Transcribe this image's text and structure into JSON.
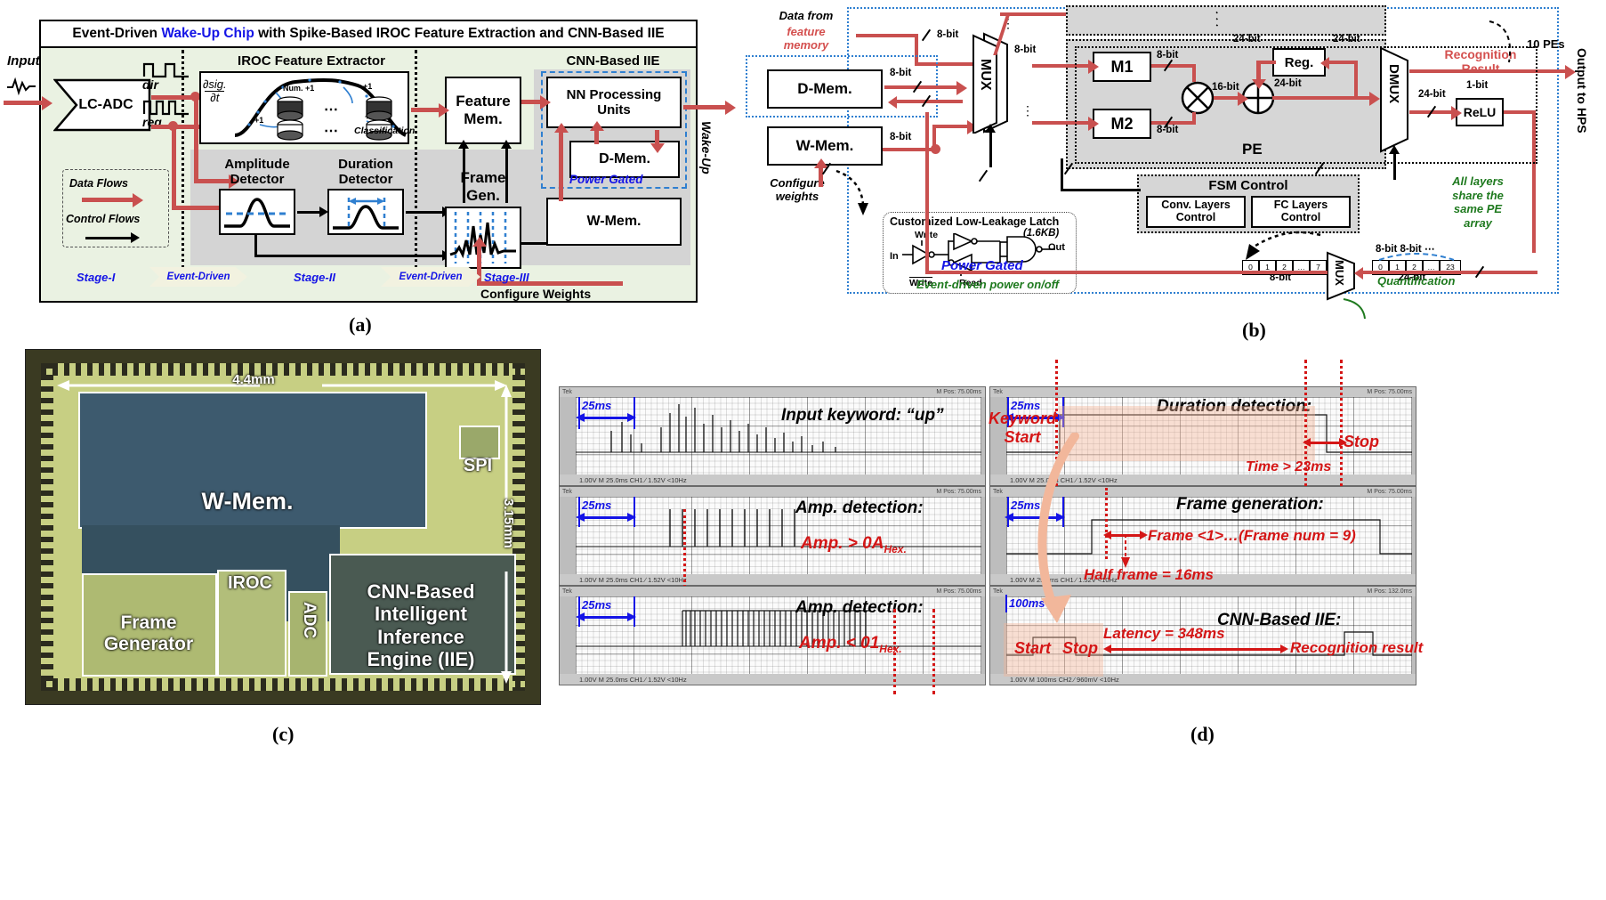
{
  "panel_a": {
    "caption": "(a)",
    "title_parts": [
      "Event-Driven ",
      "Wake-Up Chip",
      " with Spike-Based IROC Feature Extraction and CNN-Based IIE"
    ],
    "title_full": "Event-Driven Wake-Up Chip with Spike-Based IROC Feature Extraction and CNN-Based IIE",
    "title_highlight": "Wake-Up Chip",
    "input_label": "Input",
    "lc_adc": "LC-ADC",
    "dir": "dir",
    "req": "req",
    "legend": {
      "data_flows": "Data Flows",
      "control_flows": "Control Flows"
    },
    "iroc_title": "IROC Feature Extractor",
    "iroc_deriv": "∂sig.",
    "iroc_deriv_den": "∂t",
    "iroc_num": "Num. +1",
    "iroc_plus1": "+1",
    "iroc_classification": "Classification",
    "amp_det": "Amplitude\nDetector",
    "dur_det": "Duration\nDetector",
    "feature_mem": "Feature\nMem.",
    "frame_gen": "Frame\nGen.",
    "cnn_iie": "CNN-Based  IIE",
    "nn_units": "NN Processing\nUnits",
    "d_mem": "D-Mem.",
    "power_gated": "Power Gated",
    "w_mem": "W-Mem.",
    "wake_up": "Wake-Up",
    "configure_weights": "Configure Weights",
    "stages": [
      "Stage-I",
      "Stage-II",
      "Stage-III"
    ],
    "event_driven": "Event-Driven"
  },
  "panel_b": {
    "caption": "(b)",
    "data_from": "Data from",
    "feature_memory": "feature\nmemory",
    "d_mem": "D-Mem.",
    "w_mem": "W-Mem.",
    "mux": "MUX",
    "dmux": "DMUX",
    "m1": "M1",
    "m2": "M2",
    "reg": "Reg.",
    "relu": "ReLU",
    "pe": "PE",
    "pes_count": "10 PEs",
    "recognition_result": "Recognition\nResult",
    "output_hps": "Output to HPS",
    "configure_weights": "Configure\nweights",
    "latch_title": "Customized Low-Leakage Latch",
    "latch_size": "(1.6KB)",
    "latch_in": "In",
    "latch_out": "Out",
    "latch_write": "Write",
    "latch_write_b": "Write",
    "latch_read": "Read",
    "fsm_control": "FSM Control",
    "conv_layers": "Conv. Layers\nControl",
    "fc_layers": "FC Layers\nControl",
    "power_gated": "Power Gated",
    "event_driven_power": "Event-driven power on/off",
    "quantification": "Quantification",
    "all_layers_note": "All layers\nshare the\nsame PE\narray",
    "bits": {
      "b8": "8-bit",
      "b16": "16-bit",
      "b24": "24-bit",
      "b1": "1-bit"
    },
    "bus8_cells": [
      "0",
      "1",
      "2",
      "…",
      "7"
    ],
    "bus24_cells": [
      "0",
      "1",
      "2",
      "…",
      "23"
    ],
    "bus8_label": "8-bit",
    "bus24_label": "24-bit",
    "bus_pair_label": "8-bit 8-bit ⋯"
  },
  "panel_c": {
    "caption": "(c)",
    "width_label": "4.4mm",
    "height_label": "3.15mm",
    "regions": [
      {
        "name": "W-Mem.",
        "label": "W-Mem."
      },
      {
        "name": "SPI",
        "label": "SPI"
      },
      {
        "name": "Frame Generator",
        "label": "Frame\nGenerator"
      },
      {
        "name": "IROC",
        "label": "IROC"
      },
      {
        "name": "ADC",
        "label": "ADC"
      },
      {
        "name": "CNN IIE",
        "label": "CNN-Based\nIntelligent\nInference\nEngine (IIE)"
      }
    ]
  },
  "panel_d": {
    "caption": "(d)",
    "scopes": [
      {
        "id": "input-keyword",
        "title": "Input keyword: “up”",
        "time_marker": "25ms",
        "top_right": "M Pos: 75.00ms",
        "bottom": "1.00V        M 25.0ms        CH1 ∕ 1.52V      <10Hz"
      },
      {
        "id": "amp-detection-high",
        "title": "Amp. detection:",
        "time_marker": "25ms",
        "annotation": "Amp. > 0A",
        "annotation_sub": "Hex.",
        "top_right": "M Pos: 75.00ms",
        "bottom": "1.00V        M 25.0ms        CH1 ∕ 1.52V      <10Hz"
      },
      {
        "id": "amp-detection-low",
        "title": "Amp. detection:",
        "time_marker": "25ms",
        "annotation": "Amp. < 01",
        "annotation_sub": "Hex.",
        "top_right": "M Pos: 75.00ms",
        "bottom": "1.00V        M 25.0ms        CH1 ∕ 1.52V      <10Hz"
      },
      {
        "id": "duration-detection",
        "title": "Duration detection:",
        "time_marker": "25ms",
        "keyword_start": "Keyword\nStart",
        "stop": "Stop",
        "annotation": "Time > 23ms",
        "top_right": "M Pos: 75.00ms",
        "bottom": "1.00V        M 25.0ms        CH1 ∕ 1.52V      <10Hz"
      },
      {
        "id": "frame-generation",
        "title": "Frame generation:",
        "time_marker": "25ms",
        "frame_label": "Frame <1>…(Frame num = 9)",
        "half_frame": "Half frame = 16ms",
        "top_right": "M Pos: 75.00ms",
        "bottom": "1.00V        M 25.0ms        CH1 ∕ 1.52V      <10Hz"
      },
      {
        "id": "cnn-based-iie",
        "title": "CNN-Based IIE:",
        "time_marker": "100ms",
        "start": "Start",
        "stop": "Stop",
        "latency": "Latency = 348ms",
        "result": "Recognition result",
        "top_right": "M Pos: 132.0ms",
        "bottom": "1.00V        M 100ms        CH2 ∕ 960mV     <10Hz"
      }
    ]
  },
  "colors": {
    "data_flow_red": "#c9504f",
    "accent_blue": "#1414e6",
    "annotation_red": "#d41616",
    "note_green": "#1f7a1f",
    "panel_green": "#eaf2e2",
    "stage_gray": "#d4d4d4"
  }
}
